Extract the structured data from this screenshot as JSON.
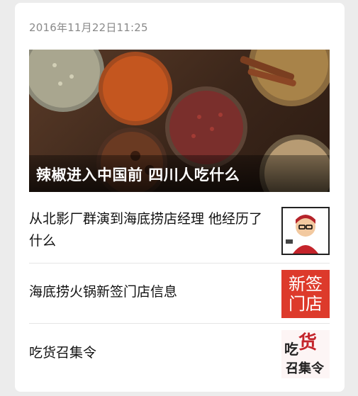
{
  "post": {
    "timestamp": "2016年11月22日11:25",
    "hero_title": "辣椒进入中国前 四川人吃什么"
  },
  "items": [
    {
      "title": "从北影厂群演到海底捞店经理 他经历了什么",
      "thumb_icon": "cartoon-portrait-icon"
    },
    {
      "title": "海底捞火锅新签门店信息",
      "thumb_icon": "red-sign-icon",
      "thumb_line1": "新签",
      "thumb_line2": "门店"
    },
    {
      "title": "吃货召集令",
      "thumb_icon": "chihuo-calligraphy-icon",
      "thumb_text": "吃货召集令"
    }
  ],
  "colors": {
    "background": "#ececec",
    "card": "#ffffff",
    "accent_red": "#dd3a2b",
    "timestamp": "#8a8a8a"
  }
}
